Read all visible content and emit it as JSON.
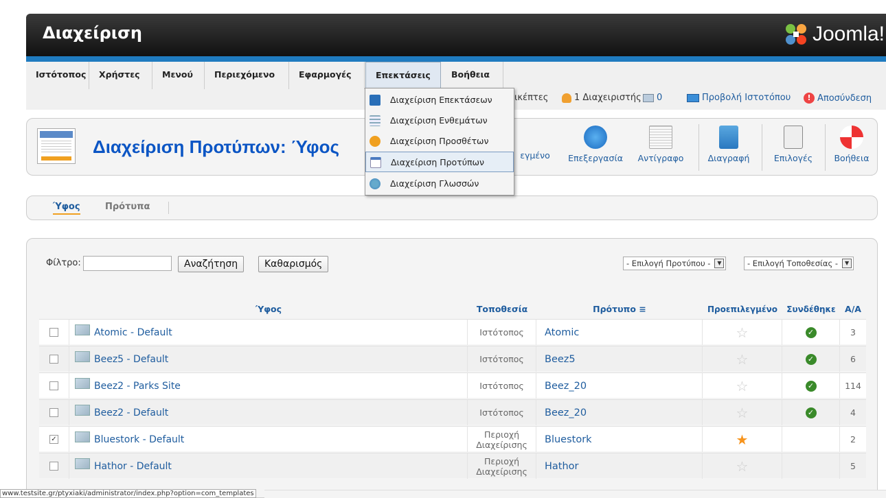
{
  "header": {
    "title": "Διαχείριση",
    "logo_text": "Joomla!"
  },
  "menu": {
    "items": [
      "Ιστότοπος",
      "Χρήστες",
      "Μενού",
      "Περιεχόμενο",
      "Εφαρμογές",
      "Επεκτάσεις",
      "Βοήθεια"
    ],
    "active": "Επεκτάσεις"
  },
  "dropdown": {
    "items": [
      "Διαχείριση Επεκτάσεων",
      "Διαχείριση Ενθεμάτων",
      "Διαχείριση Προσθέτων",
      "Διαχείριση Προτύπων",
      "Διαχείριση Γλωσσών"
    ],
    "selected": "Διαχείριση Προτύπων"
  },
  "status": {
    "visitors": "ικέπτες",
    "admins": "1 Διαχειριστής",
    "messages": "0",
    "view_site": "Προβολή Ιστοτόπου",
    "logout": "Αποσύνδεση"
  },
  "toolbar": {
    "title": "Διαχείριση Προτύπων: Ύφος",
    "default_partial": "εγμένο",
    "edit": "Επεξεργασία",
    "copy": "Αντίγραφο",
    "delete": "Διαγραφή",
    "options": "Επιλογές",
    "help": "Βοήθεια"
  },
  "subtabs": {
    "styles": "Ύφος",
    "templates": "Πρότυπα"
  },
  "filter": {
    "label": "Φίλτρο:",
    "value": "",
    "search_button": "Αναζήτηση",
    "clear_button": "Καθαρισμός",
    "template_select": "- Επιλογή Προτύπου -",
    "location_select": "- Επιλογή Τοποθεσίας -"
  },
  "table": {
    "headers": {
      "style": "Ύφος",
      "location": "Τοποθεσία",
      "template": "Πρότυπο",
      "default": "Προεπιλεγμένο",
      "assigned": "Συνδέθηκε",
      "id": "Α/Α"
    },
    "rows": [
      {
        "checked": false,
        "style": "Atomic - Default",
        "location": "Ιστότοπος",
        "template": "Atomic",
        "default": false,
        "assigned": true,
        "id": "3"
      },
      {
        "checked": false,
        "style": "Beez5 - Default",
        "location": "Ιστότοπος",
        "template": "Beez5",
        "default": false,
        "assigned": true,
        "id": "6"
      },
      {
        "checked": false,
        "style": "Beez2 - Parks Site",
        "location": "Ιστότοπος",
        "template": "Beez_20",
        "default": false,
        "assigned": true,
        "id": "114"
      },
      {
        "checked": false,
        "style": "Beez2 - Default",
        "location": "Ιστότοπος",
        "template": "Beez_20",
        "default": false,
        "assigned": true,
        "id": "4"
      },
      {
        "checked": true,
        "style": "Bluestork - Default",
        "location": "Περιοχή Διαχείρισης",
        "template": "Bluestork",
        "default": true,
        "assigned": false,
        "id": "2"
      },
      {
        "checked": false,
        "style": "Hathor - Default",
        "location": "Περιοχή Διαχείρισης",
        "template": "Hathor",
        "default": false,
        "assigned": false,
        "id": "5"
      }
    ]
  },
  "statusbar": {
    "url": "www.testsite.gr/ptyxiaki/administrator/index.php?option=com_templates"
  },
  "colors": {
    "accent_blue": "#1f7bc0",
    "link": "#1e5c9e",
    "title": "#0b55c4",
    "star_on": "#f7941d"
  }
}
